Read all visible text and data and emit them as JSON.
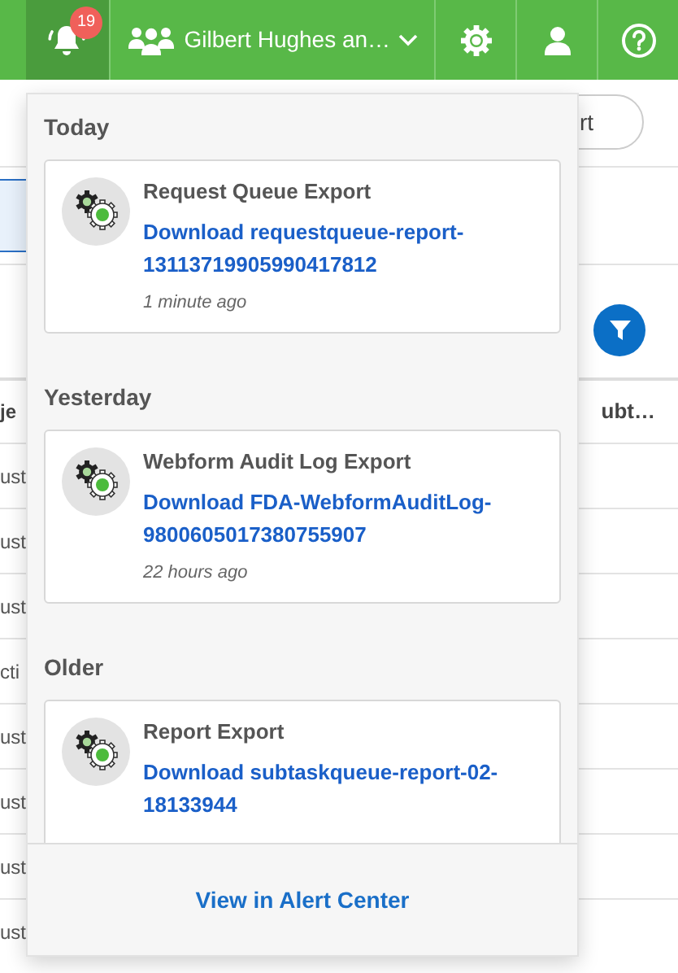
{
  "top_bar": {
    "items": [
      {
        "kind": "bell",
        "selected": true,
        "badge": "19"
      },
      {
        "kind": "account",
        "selected": false,
        "label": "Gilbert Hughes an…"
      },
      {
        "kind": "settings",
        "selected": false
      },
      {
        "kind": "user",
        "selected": false
      },
      {
        "kind": "help",
        "selected": false
      }
    ]
  },
  "background": {
    "button_label": "rt",
    "columns": [
      "je",
      "ubt…"
    ],
    "rows": [
      "ust",
      "ust",
      "ust",
      "cti",
      "ust",
      "ust",
      "ust",
      "ust"
    ]
  },
  "notifications": {
    "groups": [
      {
        "heading": "Today",
        "items": [
          {
            "title": "Request Queue Export",
            "link": "Download requestqueue-report-13113719905990417812",
            "time": "1 minute ago"
          }
        ]
      },
      {
        "heading": "Yesterday",
        "items": [
          {
            "title": "Webform Audit Log Export",
            "link": "Download FDA-WebformAuditLog-9800605017380755907",
            "time": "22 hours ago"
          }
        ]
      },
      {
        "heading": "Older",
        "items": [
          {
            "title": "Report Export",
            "link": "Download subtaskqueue-report-02-18133944"
          }
        ]
      }
    ],
    "footer_link": "View in Alert Center"
  }
}
